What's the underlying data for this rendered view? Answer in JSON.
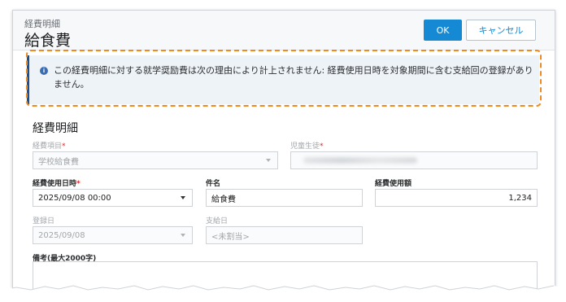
{
  "header": {
    "subtitle": "経費明細",
    "title": "給食費",
    "ok_label": "OK",
    "cancel_label": "キャンセル"
  },
  "notice": {
    "icon": "info-icon",
    "text": "この経費明細に対する就学奨励費は次の理由により計上されません: 経費使用日時を対象期間に含む支給回の登録がありません。"
  },
  "section": {
    "title": "経費明細"
  },
  "form": {
    "expense_item": {
      "label": "経費項目",
      "required_mark": "*",
      "value": "学校給食費"
    },
    "student": {
      "label": "児童生徒",
      "required_mark": "*"
    },
    "use_datetime": {
      "label": "経費使用日時",
      "required_mark": "*",
      "value": "2025/09/08 00:00"
    },
    "subject": {
      "label": "件名",
      "value": "給食費"
    },
    "amount": {
      "label": "経費使用額",
      "value": "1,234"
    },
    "registered_date": {
      "label": "登録日",
      "value": "2025/09/08"
    },
    "payment_date": {
      "label": "支給日",
      "value": "<未割当>"
    },
    "remarks": {
      "label": "備考(最大2000字)"
    }
  },
  "colors": {
    "accent": "#1589d4",
    "highlight": "#ee8a20",
    "required": "#d9272e"
  }
}
